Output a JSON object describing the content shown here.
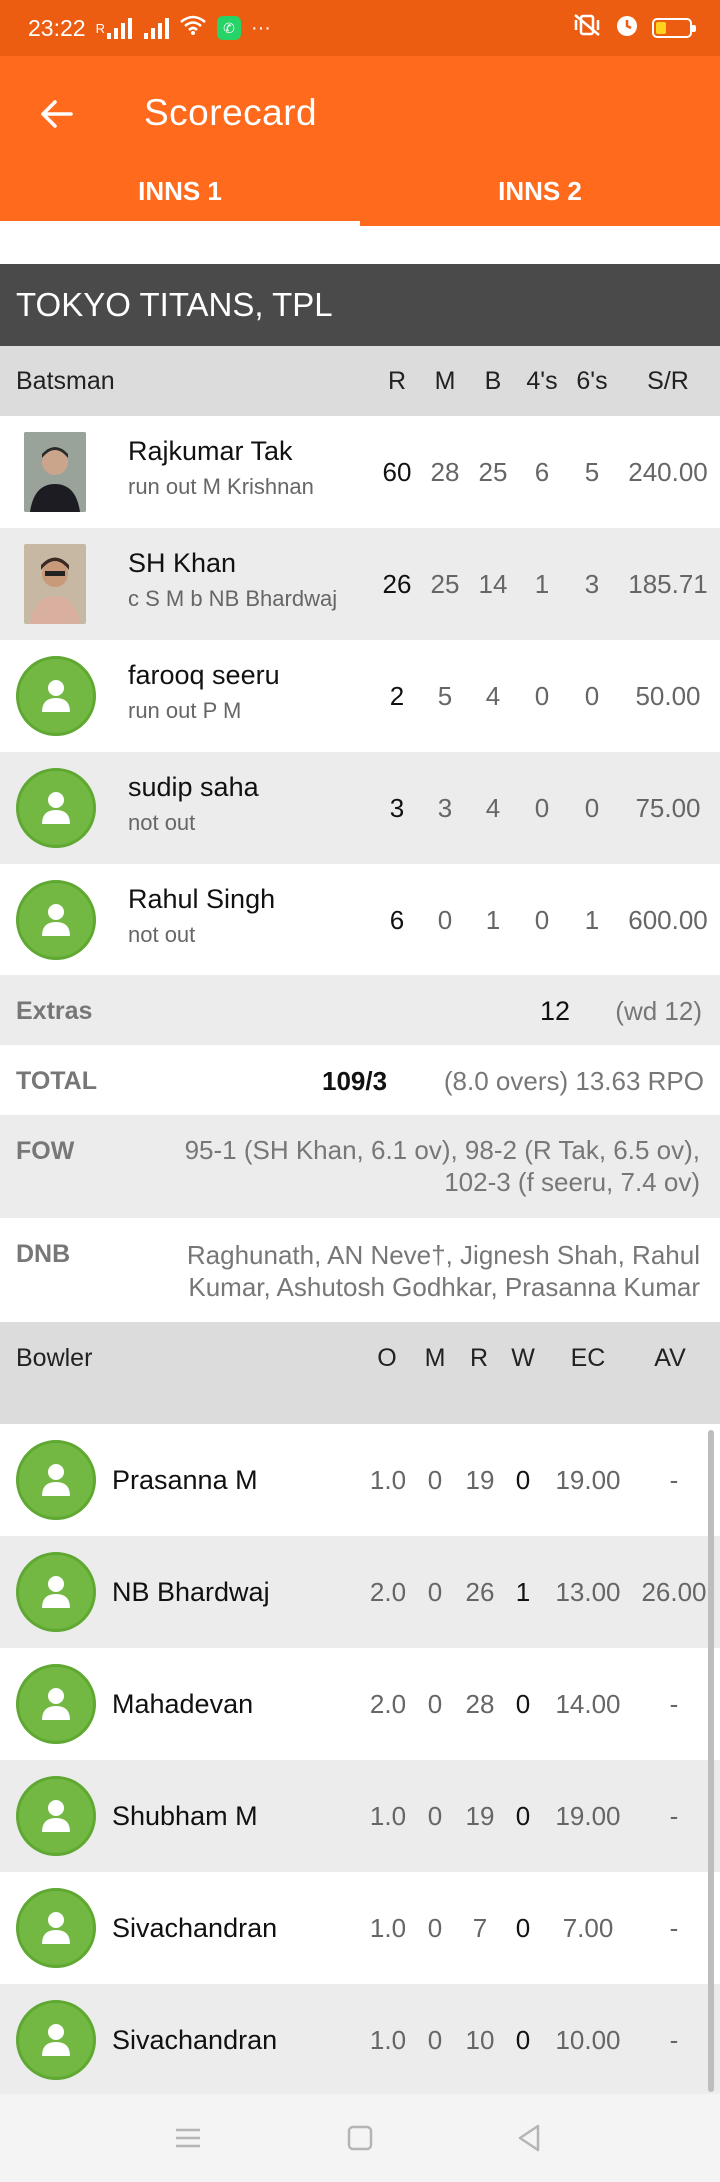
{
  "status": {
    "time": "23:22",
    "signal_label": "R"
  },
  "appbar": {
    "title": "Scorecard"
  },
  "tabs": [
    {
      "label": "INNS 1"
    },
    {
      "label": "INNS 2"
    }
  ],
  "team": "TOKYO TITANS, TPL",
  "batting_header": {
    "label": "Batsman",
    "cols": [
      "R",
      "M",
      "B",
      "4's",
      "6's",
      "S/R"
    ]
  },
  "batsmen": [
    {
      "name": "Rajkumar Tak",
      "dismissal": "run out M Krishnan",
      "r": "60",
      "m": "28",
      "b": "25",
      "fours": "6",
      "sixes": "5",
      "sr": "240.00",
      "avatar": "photo-1"
    },
    {
      "name": "SH Khan",
      "dismissal": "c S M b NB Bhardwaj",
      "r": "26",
      "m": "25",
      "b": "14",
      "fours": "1",
      "sixes": "3",
      "sr": "185.71",
      "avatar": "photo-2"
    },
    {
      "name": "farooq seeru",
      "dismissal": "run out P M",
      "r": "2",
      "m": "5",
      "b": "4",
      "fours": "0",
      "sixes": "0",
      "sr": "50.00",
      "avatar": "placeholder"
    },
    {
      "name": "sudip saha",
      "dismissal": "not out",
      "r": "3",
      "m": "3",
      "b": "4",
      "fours": "0",
      "sixes": "0",
      "sr": "75.00",
      "avatar": "placeholder"
    },
    {
      "name": "Rahul Singh",
      "dismissal": "not out",
      "r": "6",
      "m": "0",
      "b": "1",
      "fours": "0",
      "sixes": "1",
      "sr": "600.00",
      "avatar": "placeholder"
    }
  ],
  "extras": {
    "label": "Extras",
    "value": "12",
    "detail": "(wd 12)"
  },
  "total": {
    "label": "TOTAL",
    "score": "109/3",
    "detail": "(8.0 overs) 13.63 RPO"
  },
  "fow": {
    "label": "FOW",
    "line1": "95-1 (SH Khan, 6.1 ov), 98-2 (R Tak, 6.5 ov),",
    "line2": "102-3 (f seeru, 7.4 ov)"
  },
  "dnb": {
    "label": "DNB",
    "line1": "Raghunath, AN Neve†, Jignesh Shah, Rahul",
    "line2": "Kumar, Ashutosh Godhkar, Prasanna Kumar"
  },
  "bowling_header": {
    "label": "Bowler",
    "cols": [
      "O",
      "M",
      "R",
      "W",
      "EC",
      "AV"
    ]
  },
  "bowlers": [
    {
      "name": "Prasanna M",
      "o": "1.0",
      "m": "0",
      "r": "19",
      "w": "0",
      "ec": "19.00",
      "av": "-"
    },
    {
      "name": "NB Bhardwaj",
      "o": "2.0",
      "m": "0",
      "r": "26",
      "w": "1",
      "ec": "13.00",
      "av": "26.00"
    },
    {
      "name": "Mahadevan",
      "o": "2.0",
      "m": "0",
      "r": "28",
      "w": "0",
      "ec": "14.00",
      "av": "-"
    },
    {
      "name": "Shubham M",
      "o": "1.0",
      "m": "0",
      "r": "19",
      "w": "0",
      "ec": "19.00",
      "av": "-"
    },
    {
      "name": "Sivachandran",
      "o": "1.0",
      "m": "0",
      "r": "7",
      "w": "0",
      "ec": "7.00",
      "av": "-"
    },
    {
      "name": "Sivachandran",
      "o": "1.0",
      "m": "0",
      "r": "10",
      "w": "0",
      "ec": "10.00",
      "av": "-"
    }
  ],
  "colors": {
    "status_bar": "#ec5d12",
    "app_bar": "#ff6a1d",
    "team_bar": "#4a4a4a",
    "avatar_green": "#72b843"
  }
}
